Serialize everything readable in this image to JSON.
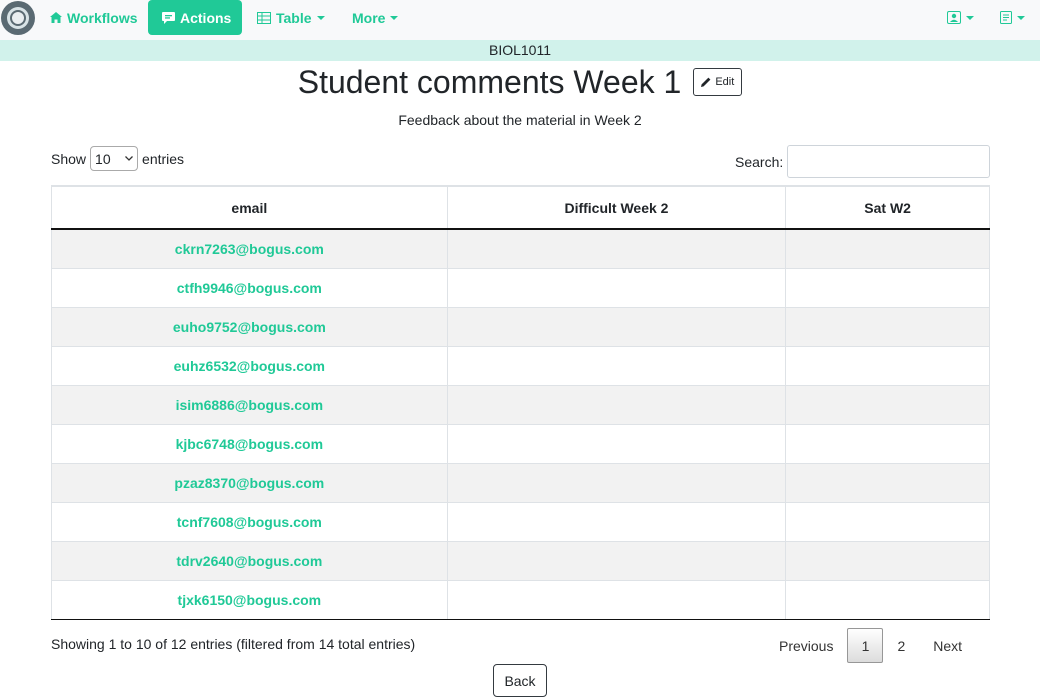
{
  "navbar": {
    "workflows_label": "Workflows",
    "actions_label": "Actions",
    "table_label": "Table",
    "more_label": "More"
  },
  "course_code": "BIOL1011",
  "page": {
    "title": "Student comments Week 1",
    "edit_label": "Edit",
    "subtitle": "Feedback about the material in Week 2"
  },
  "controls": {
    "show_label": "Show",
    "entries_value": "10",
    "entries_label": "entries",
    "search_label": "Search:",
    "search_value": ""
  },
  "table": {
    "columns": [
      "email",
      "Difficult Week 2",
      "Sat W2"
    ],
    "rows": [
      [
        "ckrn7263@bogus.com",
        "",
        ""
      ],
      [
        "ctfh9946@bogus.com",
        "",
        ""
      ],
      [
        "euho9752@bogus.com",
        "",
        ""
      ],
      [
        "euhz6532@bogus.com",
        "",
        ""
      ],
      [
        "isim6886@bogus.com",
        "",
        ""
      ],
      [
        "kjbc6748@bogus.com",
        "",
        ""
      ],
      [
        "pzaz8370@bogus.com",
        "",
        ""
      ],
      [
        "tcnf7608@bogus.com",
        "",
        ""
      ],
      [
        "tdrv2640@bogus.com",
        "",
        ""
      ],
      [
        "tjxk6150@bogus.com",
        "",
        ""
      ]
    ]
  },
  "footer": {
    "info": "Showing 1 to 10 of 12 entries (filtered from 14 total entries)",
    "previous_label": "Previous",
    "pages": [
      "1",
      "2"
    ],
    "current_page": "1",
    "next_label": "Next",
    "back_label": "Back"
  },
  "colors": {
    "accent": "#20c997",
    "course_bar": "#d1f2eb"
  }
}
